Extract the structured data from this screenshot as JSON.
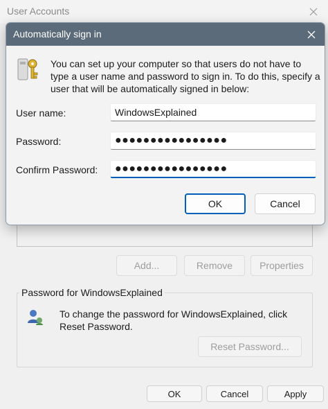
{
  "background_window": {
    "title": "User Accounts",
    "buttons": {
      "add": "Add...",
      "remove": "Remove",
      "properties": "Properties"
    },
    "password_group": {
      "title": "Password for WindowsExplained",
      "text": "To change the password for WindowsExplained, click Reset Password.",
      "reset_button": "Reset Password..."
    },
    "footer": {
      "ok": "OK",
      "cancel": "Cancel",
      "apply": "Apply"
    }
  },
  "dialog": {
    "title": "Automatically sign in",
    "description": "You can set up your computer so that users do not have to type a user name and password to sign in. To do this, specify a user that will be automatically signed in below:",
    "fields": {
      "username_label": "User name:",
      "username_value": "WindowsExplained",
      "password_label": "Password:",
      "password_value": "●●●●●●●●●●●●●●●●",
      "confirm_label": "Confirm Password:",
      "confirm_value": "●●●●●●●●●●●●●●●●"
    },
    "ok_button": "OK",
    "cancel_button": "Cancel"
  },
  "colors": {
    "dialog_titlebar": "#5b6b7a",
    "accent": "#005fb8"
  }
}
